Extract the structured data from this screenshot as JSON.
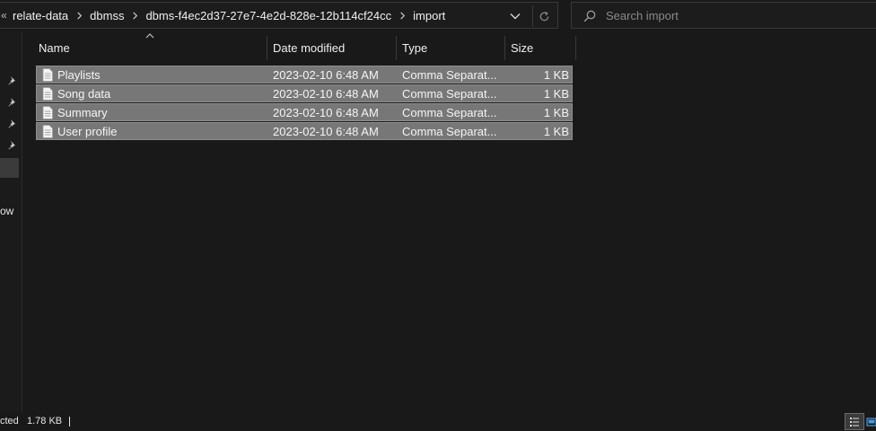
{
  "address_bar": {
    "leading_glyph": "«",
    "crumbs": [
      "relate-data",
      "dbmss",
      "dbms-f4ec2d37-27e7-4e2d-828e-12b114cf24cc",
      "import"
    ],
    "dropdown_icon": "chevron-down-icon",
    "refresh_icon": "refresh-icon"
  },
  "search": {
    "placeholder": "Search import",
    "value": "",
    "icon": "search-icon"
  },
  "nav": {
    "pinned_icons": [
      "pin-icon",
      "pin-icon",
      "pin-icon",
      "pin-icon"
    ],
    "partial_label": "ow"
  },
  "columns": {
    "name": "Name",
    "date_modified": "Date modified",
    "type": "Type",
    "size": "Size"
  },
  "files": [
    {
      "name": "Playlists",
      "date": "2023-02-10 6:48 AM",
      "type": "Comma Separat...",
      "size": "1 KB"
    },
    {
      "name": "Song data",
      "date": "2023-02-10 6:48 AM",
      "type": "Comma Separat...",
      "size": "1 KB"
    },
    {
      "name": "Summary",
      "date": "2023-02-10 6:48 AM",
      "type": "Comma Separat...",
      "size": "1 KB"
    },
    {
      "name": "User profile",
      "date": "2023-02-10 6:48 AM",
      "type": "Comma Separat...",
      "size": "1 KB"
    }
  ],
  "status": {
    "selection_text": "cted",
    "selection_size": "1.78 KB"
  },
  "colors": {
    "background": "#191919",
    "selected_row": "#777777",
    "border": "#3a3a3a"
  }
}
